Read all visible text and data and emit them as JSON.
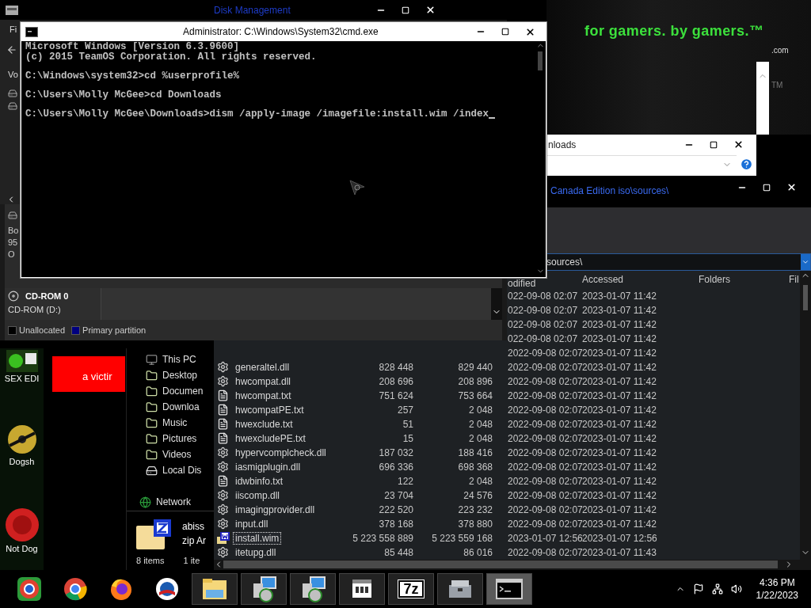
{
  "wallpaper": {
    "slogan": "for gamers. by gamers.™",
    "domain": ".com",
    "trademark": "TM"
  },
  "disk_management": {
    "title": "Disk Management",
    "menu_fragment": "Fi",
    "column_fragment": "Vo",
    "disk_fragments": [
      "Bo",
      "95",
      "O"
    ],
    "cd_rom": {
      "name": "CD-ROM 0",
      "drive": "CD-ROM (D:)"
    },
    "legend": [
      {
        "label": "Unallocated",
        "color": "#000000"
      },
      {
        "label": "Primary partition",
        "color": "#000080"
      }
    ]
  },
  "cmd": {
    "title": "Administrator: C:\\Windows\\System32\\cmd.exe",
    "cursor": true,
    "blocks": [
      {
        "lines": [
          "Microsoft Windows [Version 6.3.9600]",
          "(c) 2015 TeamOS Corporation. All rights reserved."
        ]
      },
      {
        "lines": [
          "C:\\Windows\\system32>cd %userprofile%"
        ]
      },
      {
        "lines": [
          "C:\\Users\\Molly McGee>cd Downloads"
        ]
      },
      {
        "lines": [
          "C:\\Users\\Molly McGee\\Downloads>dism /apply-image /imagefile:install.wim /index"
        ]
      }
    ]
  },
  "download_dialog": {
    "title_fragment": "nloads"
  },
  "explorer": {
    "path_fragment": "Canada Edition iso\\sources\\",
    "address": "sources\\",
    "columns": [
      "odified",
      "Accessed",
      "Folders",
      "Fil"
    ],
    "nav": [
      {
        "label": "This PC",
        "kind": "pc"
      },
      {
        "label": "Desktop",
        "kind": "folder"
      },
      {
        "label": "Documen",
        "kind": "folder"
      },
      {
        "label": "Downloa",
        "kind": "folder"
      },
      {
        "label": "Music",
        "kind": "folder"
      },
      {
        "label": "Pictures",
        "kind": "folder"
      },
      {
        "label": "Videos",
        "kind": "folder"
      },
      {
        "label": "Local Dis",
        "kind": "drive"
      },
      {
        "label": "Network",
        "kind": "network"
      }
    ],
    "rows": [
      {
        "modified": "022-09-08 02:07",
        "accessed": "2023-01-07 11:42",
        "selected": false
      },
      {
        "modified": "022-09-08 02:07",
        "accessed": "2023-01-07 11:42",
        "selected": false
      },
      {
        "modified": "022-09-08 02:07",
        "accessed": "2023-01-07 11:42",
        "selected": false
      },
      {
        "modified": "022-09-08 02:07",
        "accessed": "2023-01-07 11:42",
        "selected": false
      },
      {
        "modified": "2022-09-08 02:07",
        "accessed": "2023-01-07 11:42",
        "selected": false
      },
      {
        "kind": "dll",
        "name": "generaltel.dll",
        "size": "828 448",
        "allocated": "829 440",
        "modified": "2022-09-08 02:07",
        "accessed": "2023-01-07 11:42",
        "selected": false
      },
      {
        "kind": "dll",
        "name": "hwcompat.dll",
        "size": "208 696",
        "allocated": "208 896",
        "modified": "2022-09-08 02:07",
        "accessed": "2023-01-07 11:42",
        "selected": false
      },
      {
        "kind": "txt",
        "name": "hwcompat.txt",
        "size": "751 624",
        "allocated": "753 664",
        "modified": "2022-09-08 02:07",
        "accessed": "2023-01-07 11:42",
        "selected": false
      },
      {
        "kind": "txt",
        "name": "hwcompatPE.txt",
        "size": "257",
        "allocated": "2 048",
        "modified": "2022-09-08 02:07",
        "accessed": "2023-01-07 11:42",
        "selected": false
      },
      {
        "kind": "txt",
        "name": "hwexclude.txt",
        "size": "51",
        "allocated": "2 048",
        "modified": "2022-09-08 02:07",
        "accessed": "2023-01-07 11:42",
        "selected": false
      },
      {
        "kind": "txt",
        "name": "hwexcludePE.txt",
        "size": "15",
        "allocated": "2 048",
        "modified": "2022-09-08 02:07",
        "accessed": "2023-01-07 11:42",
        "selected": false
      },
      {
        "kind": "dll",
        "name": "hypervcomplcheck.dll",
        "size": "187 032",
        "allocated": "188 416",
        "modified": "2022-09-08 02:07",
        "accessed": "2023-01-07 11:42",
        "selected": false
      },
      {
        "kind": "dll",
        "name": "iasmigplugin.dll",
        "size": "696 336",
        "allocated": "698 368",
        "modified": "2022-09-08 02:07",
        "accessed": "2023-01-07 11:42",
        "selected": false
      },
      {
        "kind": "txt",
        "name": "idwbinfo.txt",
        "size": "122",
        "allocated": "2 048",
        "modified": "2022-09-08 02:07",
        "accessed": "2023-01-07 11:42",
        "selected": false
      },
      {
        "kind": "dll",
        "name": "iiscomp.dll",
        "size": "23 704",
        "allocated": "24 576",
        "modified": "2022-09-08 02:07",
        "accessed": "2023-01-07 11:42",
        "selected": false
      },
      {
        "kind": "dll",
        "name": "imagingprovider.dll",
        "size": "222 520",
        "allocated": "223 232",
        "modified": "2022-09-08 02:07",
        "accessed": "2023-01-07 11:42",
        "selected": false
      },
      {
        "kind": "dll",
        "name": "input.dll",
        "size": "378 168",
        "allocated": "378 880",
        "modified": "2022-09-08 02:07",
        "accessed": "2023-01-07 11:42",
        "selected": false
      },
      {
        "kind": "wim",
        "name": "install.wim",
        "size": "5 223 558 889",
        "allocated": "5 223 559 168",
        "modified": "2023-01-07 12:56",
        "accessed": "2023-01-07 12:56",
        "selected": true
      },
      {
        "kind": "dll",
        "name": "itetupg.dll",
        "size": "85 448",
        "allocated": "86 016",
        "modified": "2022-09-08 02:07",
        "accessed": "2023-01-07 11:43",
        "selected": false
      }
    ]
  },
  "zip_window": {
    "name_lines": [
      "abiss",
      "zip Ar"
    ],
    "status": [
      "8 items",
      "1 ite"
    ]
  },
  "ad": {
    "text": "a victir"
  },
  "desktop_icons": [
    {
      "label": "SEX EDI",
      "kind": "game"
    },
    {
      "label": "Dogsh",
      "kind": "disc"
    },
    {
      "label": "Not Dog",
      "kind": "ide"
    }
  ],
  "taskbar": {
    "apps": [
      {
        "kind": "chromium",
        "active": false
      },
      {
        "kind": "chrome",
        "active": false
      },
      {
        "kind": "firefox",
        "active": false
      },
      {
        "kind": "logo",
        "active": false
      },
      {
        "kind": "explorer",
        "active": false
      },
      {
        "kind": "installer",
        "active": false
      },
      {
        "kind": "installer",
        "active": false
      },
      {
        "kind": "store",
        "active": false
      },
      {
        "kind": "sevenzip",
        "label": "7z",
        "active": false
      },
      {
        "kind": "toolbox",
        "active": false
      },
      {
        "kind": "terminal",
        "active": true
      }
    ],
    "clock": {
      "time": "4:36 PM",
      "date": "1/22/2023"
    }
  }
}
